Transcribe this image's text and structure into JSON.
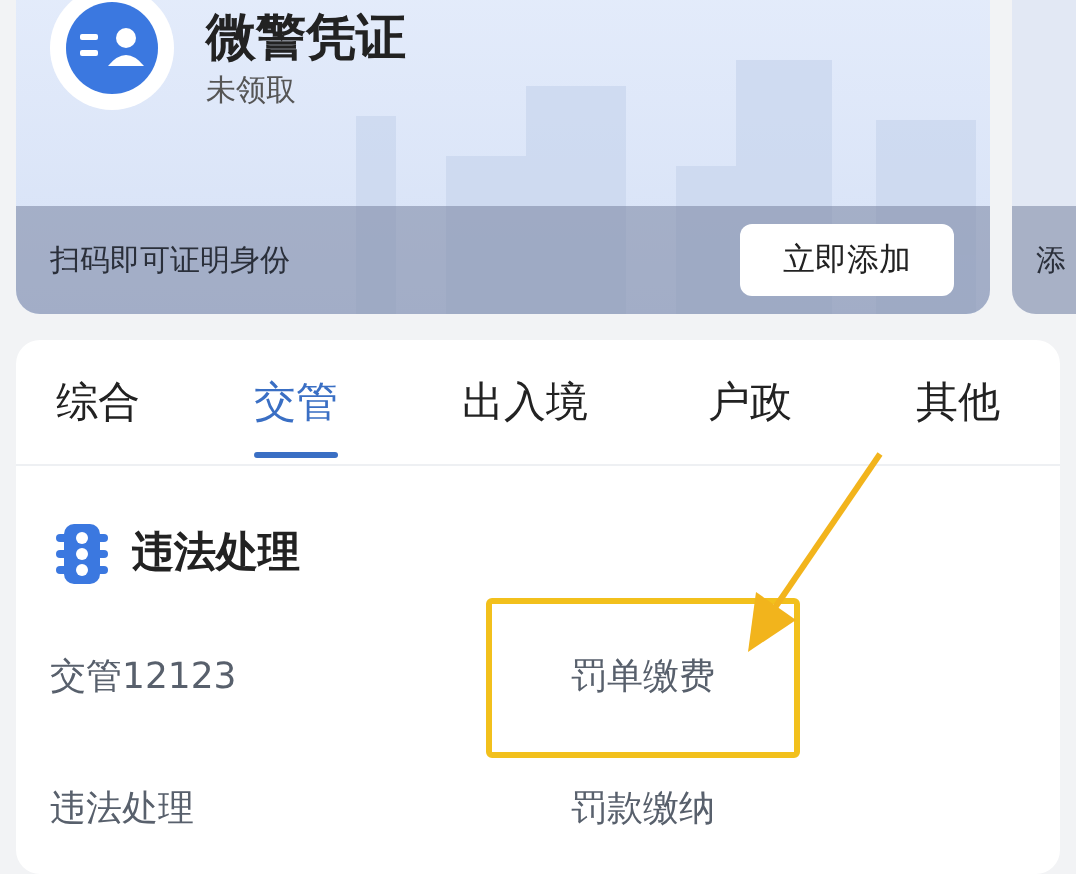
{
  "credential_card": {
    "title": "微警凭证",
    "status": "未领取",
    "hint": "扫码即可证明身份",
    "button": "立即添加"
  },
  "next_card": {
    "button": "添"
  },
  "tabs": [
    {
      "label": "综合",
      "selected": false
    },
    {
      "label": "交管",
      "selected": true
    },
    {
      "label": "出入境",
      "selected": false
    },
    {
      "label": "户政",
      "selected": false
    },
    {
      "label": "其他",
      "selected": false
    }
  ],
  "section": {
    "title": "违法处理",
    "items": [
      {
        "label": "交管12123",
        "highlighted": false
      },
      {
        "label": "罚单缴费",
        "highlighted": true
      },
      {
        "label": "违法处理",
        "highlighted": false
      },
      {
        "label": "罚款缴纳",
        "highlighted": false
      }
    ]
  }
}
